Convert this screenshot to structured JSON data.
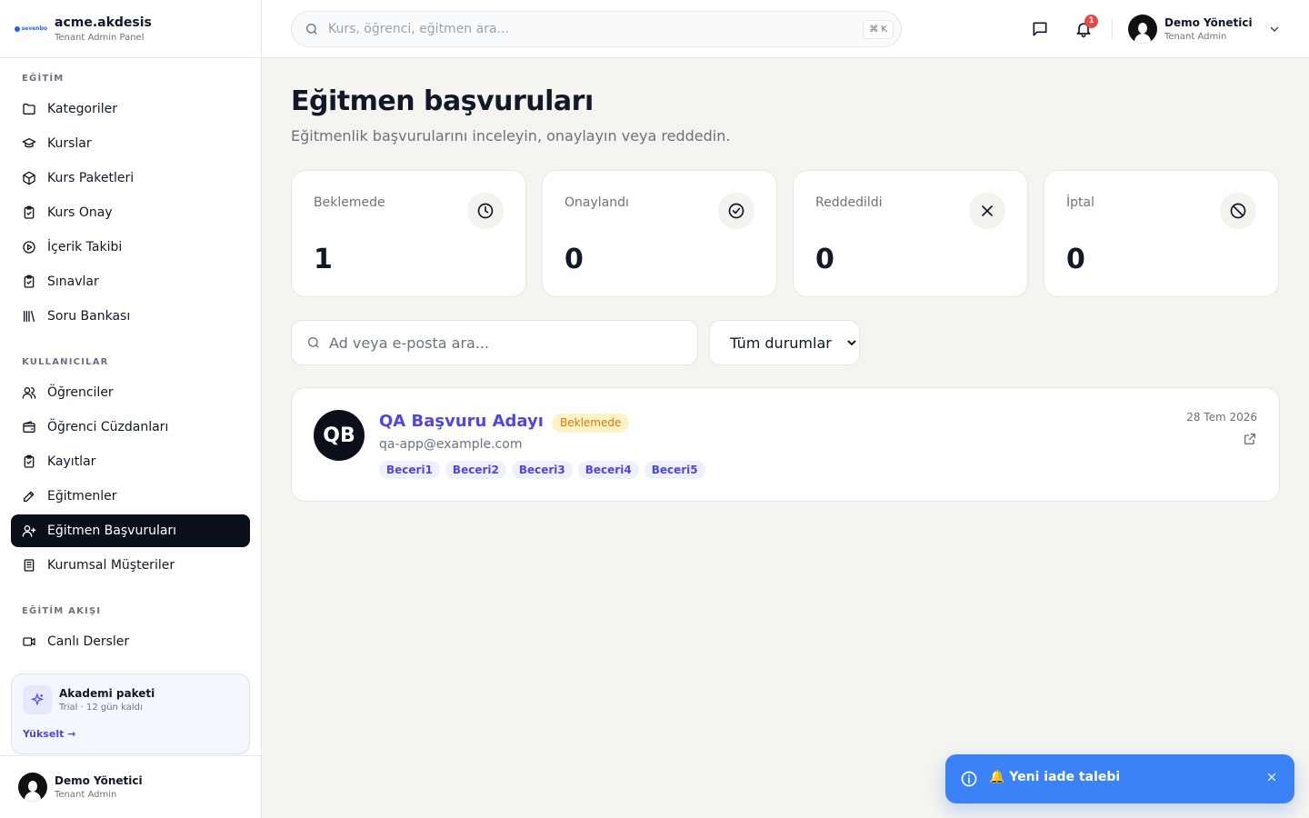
{
  "brand": {
    "logo_text": "sevenbo",
    "name": "acme.akdesis",
    "subtitle": "Tenant Admin Panel"
  },
  "sidebar": {
    "sections": [
      {
        "title": "EĞİTİM",
        "items": [
          {
            "label": "Kategoriler",
            "icon": "folder-icon"
          },
          {
            "label": "Kurslar",
            "icon": "graduation-cap-icon"
          },
          {
            "label": "Kurs Paketleri",
            "icon": "package-icon"
          },
          {
            "label": "Kurs Onay",
            "icon": "clipboard-check-icon"
          },
          {
            "label": "İçerik Takibi",
            "icon": "play-circle-icon"
          },
          {
            "label": "Sınavlar",
            "icon": "clipboard-check-icon"
          },
          {
            "label": "Soru Bankası",
            "icon": "library-icon"
          }
        ]
      },
      {
        "title": "KULLANICILAR",
        "items": [
          {
            "label": "Öğrenciler",
            "icon": "users-icon"
          },
          {
            "label": "Öğrenci Cüzdanları",
            "icon": "wallet-icon"
          },
          {
            "label": "Kayıtlar",
            "icon": "clipboard-check-icon"
          },
          {
            "label": "Eğitmenler",
            "icon": "pencil-icon"
          },
          {
            "label": "Eğitmen Başvuruları",
            "icon": "user-plus-icon",
            "active": true
          },
          {
            "label": "Kurumsal Müşteriler",
            "icon": "building-icon"
          }
        ]
      },
      {
        "title": "EĞİTİM AKIŞI",
        "items": [
          {
            "label": "Canlı Dersler",
            "icon": "video-icon"
          }
        ]
      }
    ],
    "plan": {
      "title": "Akademi paketi",
      "subtitle": "Trial · 12 gün kaldı",
      "link": "Yükselt →"
    },
    "user": {
      "name": "Demo Yönetici",
      "role": "Tenant Admin"
    }
  },
  "header": {
    "search_placeholder": "Kurs, öğrenci, eğitmen ara...",
    "shortcut": "⌘ K",
    "notification_count": "1",
    "user": {
      "name": "Demo Yönetici",
      "role": "Tenant Admin"
    }
  },
  "page": {
    "title": "Eğitmen başvuruları",
    "subtitle": "Eğitmenlik başvurularını inceleyin, onaylayın veya reddedin."
  },
  "stats": [
    {
      "label": "Beklemede",
      "value": "1",
      "icon": "clock-icon"
    },
    {
      "label": "Onaylandı",
      "value": "0",
      "icon": "check-circle-icon"
    },
    {
      "label": "Reddedildi",
      "value": "0",
      "icon": "x-icon"
    },
    {
      "label": "İptal",
      "value": "0",
      "icon": "ban-icon"
    }
  ],
  "filters": {
    "search_placeholder": "Ad veya e-posta ara...",
    "status_selected": "Tüm durumlar"
  },
  "applications": [
    {
      "initials": "QB",
      "name": "QA Başvuru Adayı",
      "status": "Beklemede",
      "email": "qa-app@example.com",
      "skills": [
        "Beceri1",
        "Beceri2",
        "Beceri3",
        "Beceri4",
        "Beceri5"
      ],
      "date": "28 Tem 2026"
    }
  ],
  "toast": {
    "text": "🔔 Yeni iade talebi",
    "icon": "info-icon"
  }
}
